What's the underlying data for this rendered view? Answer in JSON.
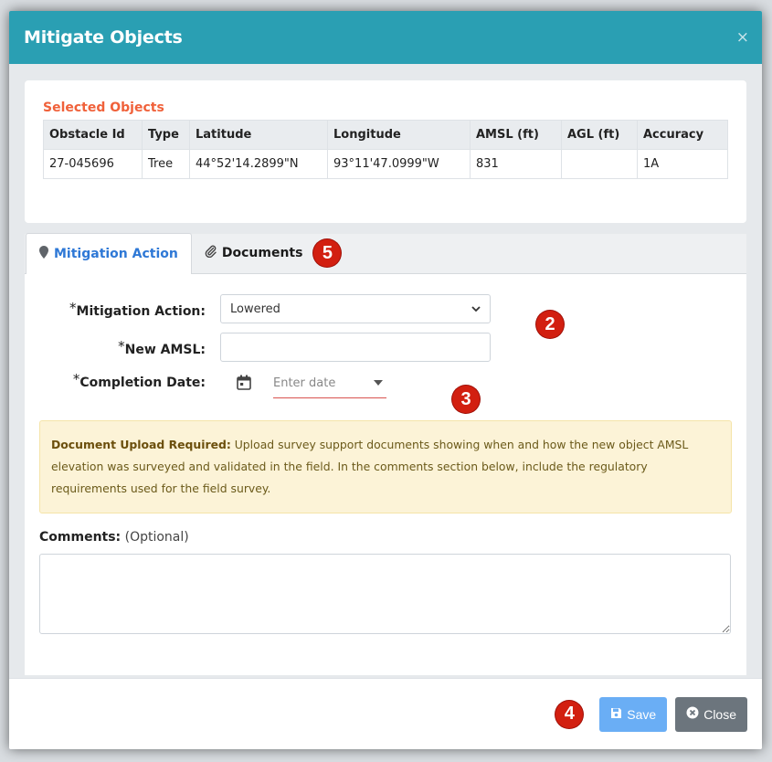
{
  "dialog": {
    "title": "Mitigate Objects",
    "close_glyph": "×"
  },
  "selected": {
    "title": "Selected Objects",
    "columns": [
      "Obstacle Id",
      "Type",
      "Latitude",
      "Longitude",
      "AMSL (ft)",
      "AGL (ft)",
      "Accuracy"
    ],
    "rows": [
      [
        "27-045696",
        "Tree",
        "44°52'14.2899\"N",
        "93°11'47.0999\"W",
        "831",
        "",
        "1A"
      ]
    ]
  },
  "tabs": [
    {
      "label": "Mitigation Action",
      "icon": "map-marker-icon",
      "active": true
    },
    {
      "label": "Documents",
      "icon": "paperclip-icon",
      "active": false
    }
  ],
  "badges": {
    "tab": "5",
    "action": "2",
    "date": "3",
    "footer": "4"
  },
  "form": {
    "required_mark": "*",
    "action_label": "Mitigation Action:",
    "action_value": "Lowered",
    "amsl_label": "New AMSL:",
    "amsl_value": "",
    "date_label": "Completion Date:",
    "date_placeholder": "Enter date"
  },
  "alert": {
    "heading": "Document Upload Required:",
    "text": " Upload survey support documents showing when and how the new object AMSL elevation was surveyed and validated in the field. In the comments section below, include the regulatory requirements used for the field survey."
  },
  "comments": {
    "label": "Comments:",
    "optional": " (Optional)",
    "value": ""
  },
  "footer": {
    "save_label": "Save",
    "close_label": "Close"
  },
  "colors": {
    "header": "#2a9fb3",
    "accent": "#f0613a",
    "badge": "#d21f10",
    "save": "#6aaef5",
    "close": "#6c757d"
  }
}
